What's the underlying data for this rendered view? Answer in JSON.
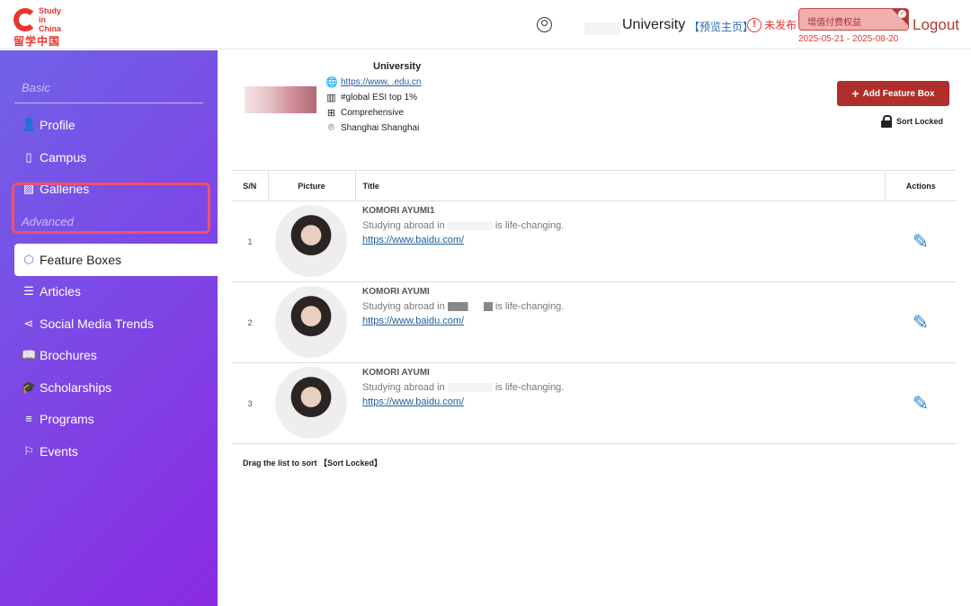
{
  "header": {
    "logo_en": "Study in China",
    "logo_cn": "留学中国",
    "university": "University",
    "preview": "【预览主页】",
    "unpublished": "未发布",
    "vip_label": "增值付费权益",
    "vip_dates": "2025-05-21 - 2025-08-20",
    "logout": "Logout"
  },
  "sidebar": {
    "section_basic": "Basic",
    "section_advanced": "Advanced",
    "items": [
      {
        "label": "Profile"
      },
      {
        "label": "Campus"
      },
      {
        "label": "Galleries"
      },
      {
        "label": "Feature Boxes"
      },
      {
        "label": "Articles"
      },
      {
        "label": "Social Media Trends"
      },
      {
        "label": "Brochures"
      },
      {
        "label": "Scholarships"
      },
      {
        "label": "Programs"
      },
      {
        "label": "Events"
      }
    ]
  },
  "university": {
    "name": "University",
    "website": "https://www.      .edu.cn",
    "ranking": "#global ESI top 1%",
    "type": "Comprehensive",
    "location": "Shanghai Shanghai"
  },
  "toolbar": {
    "add_label": "Add Feature Box",
    "sort_label": "Sort Locked"
  },
  "table": {
    "headers": [
      "S/N",
      "Picture",
      "Title",
      "Actions"
    ],
    "rows": [
      {
        "sn": "1",
        "name": "KOMORI AYUMI1",
        "desc_pre": "Studying abroad in",
        "desc_post": "is life-changing.",
        "link": "https://www.baidu.com/"
      },
      {
        "sn": "2",
        "name": "KOMORI AYUMI",
        "desc_pre": "Studying abroad in",
        "desc_post": "is life-changing.",
        "link": "https://www.baidu.com/"
      },
      {
        "sn": "3",
        "name": "KOMORI AYUMI",
        "desc_pre": "Studying abroad in",
        "desc_post": "is life-changing.",
        "link": "https://www.baidu.com/"
      }
    ]
  },
  "footer_note": "Drag the list to sort 【Sort Locked】"
}
